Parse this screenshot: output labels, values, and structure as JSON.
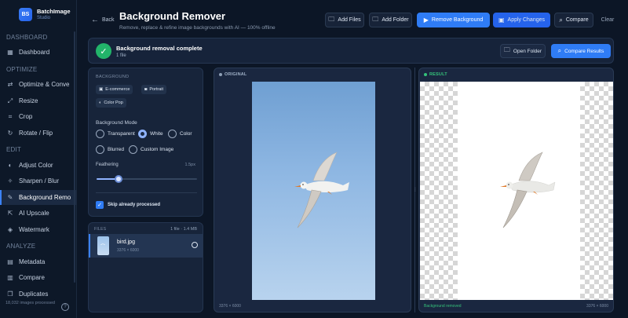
{
  "app": {
    "name": "BatchImage",
    "subtitle": "Studio",
    "logo_text": "BS",
    "accent": "#2f7cf5"
  },
  "sidebar": {
    "sections": [
      {
        "label": "DASHBOARD"
      },
      {
        "label": "OPTIMIZE"
      },
      {
        "label": "EDIT"
      },
      {
        "label": "ANALYZE"
      }
    ],
    "items": [
      {
        "label": "Dashboard",
        "icon": "grid-icon"
      },
      {
        "label": "Optimize & Conve",
        "icon": "swap-arrows-icon"
      },
      {
        "label": "Resize",
        "icon": "resize-icon"
      },
      {
        "label": "Crop",
        "icon": "crop-icon"
      },
      {
        "label": "Rotate / Flip",
        "icon": "rotate-icon"
      },
      {
        "label": "Adjust Color",
        "icon": "palette-icon"
      },
      {
        "label": "Sharpen / Blur",
        "icon": "sparkle-icon"
      },
      {
        "label": "Background Remo",
        "icon": "pen-icon",
        "active": true
      },
      {
        "label": "AI Upscale",
        "icon": "upscale-icon"
      },
      {
        "label": "Watermark",
        "icon": "droplet-icon"
      },
      {
        "label": "Metadata",
        "icon": "metadata-icon"
      },
      {
        "label": "Compare",
        "icon": "compare-icon"
      },
      {
        "label": "Duplicates",
        "icon": "duplicates-icon"
      }
    ],
    "footer": "18,032 images processed",
    "help": "?"
  },
  "header": {
    "back": "Back",
    "title": "Background Remover",
    "subtitle": "Remove, replace & refine image backgrounds with AI — 100% offline",
    "buttons": {
      "add_files": "Add Files",
      "add_folder": "Add Folder",
      "remove_bg": "Remove Background",
      "apply": "Apply Changes",
      "compare": "Compare",
      "clear": "Clear"
    }
  },
  "banner": {
    "title": "Background removal complete",
    "subtitle": "1 file",
    "open_folder": "Open Folder",
    "compare_results": "Compare Results",
    "success_color": "#22b46a"
  },
  "settings": {
    "background_label": "BACKGROUND",
    "presets": [
      "E-commerce",
      "Portrait",
      "Color Pop"
    ],
    "mode_title": "Background Mode",
    "modes": [
      "Transparent",
      "White",
      "Color",
      "Blurred",
      "Custom Image"
    ],
    "selected_mode": "White",
    "feathering_label": "Feathering",
    "feathering_value": "1.5px",
    "feathering_level": 0.22,
    "skip_processed": "Skip already processed",
    "skip_checked": true
  },
  "files": {
    "title": "FILES",
    "meta": "1 file · 1.4 MB",
    "items": [
      {
        "name": "bird.jpg",
        "dims": "3376 × 6000"
      }
    ]
  },
  "preview": {
    "original_label": "ORIGINAL",
    "result_label": "RESULT",
    "original_dims": "3376 × 6000",
    "result_status": "Background removed",
    "result_dims": "3376 × 6000"
  }
}
